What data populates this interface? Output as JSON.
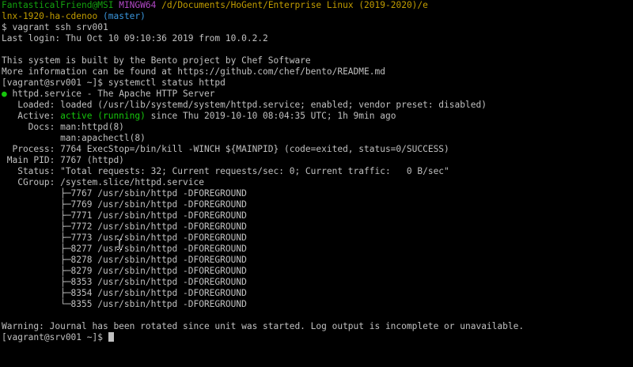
{
  "prompt": {
    "user_host": "FantasticalFriend@MSI",
    "env": "MINGW64",
    "path": "/d/Documents/HoGent/Enterprise Linux (2019-2020)/e",
    "path_cont": "lnx-1920-ha-cdenoo",
    "branch": "(master)",
    "symbol": "$",
    "command": "vagrant ssh srv001"
  },
  "login": "Last login: Thu Oct 10 09:10:36 2019 from 10.0.2.2",
  "motd": [
    "This system is built by the Bento project by Chef Software",
    "More information can be found at https://github.com/chef/bento/README.md"
  ],
  "remote_prompt_1": "[vagrant@srv001 ~]$ systemctl status httpd",
  "status": {
    "bullet": "●",
    "title": " httpd.service - The Apache HTTP Server",
    "loaded": "   Loaded: loaded (/usr/lib/systemd/system/httpd.service; enabled; vendor preset: disabled)",
    "active_label": "   Active: ",
    "active_value": "active (running)",
    "active_rest": " since Thu 2019-10-10 08:04:35 UTC; 1h 9min ago",
    "docs_1": "     Docs: man:httpd(8)",
    "docs_2": "           man:apachectl(8)",
    "process": "  Process: 7764 ExecStop=/bin/kill -WINCH ${MAINPID} (code=exited, status=0/SUCCESS)",
    "main_pid": " Main PID: 7767 (httpd)",
    "status_line": "   Status: \"Total requests: 32; Current requests/sec: 0; Current traffic:   0 B/sec\"",
    "cgroup": "   CGroup: /system.slice/httpd.service",
    "tree": [
      "           ├─7767 /usr/sbin/httpd -DFOREGROUND",
      "           ├─7769 /usr/sbin/httpd -DFOREGROUND",
      "           ├─7771 /usr/sbin/httpd -DFOREGROUND",
      "           ├─7772 /usr/sbin/httpd -DFOREGROUND",
      "           ├─7773 /usr/sbin/httpd -DFOREGROUND",
      "           ├─8277 /usr/sbin/httpd -DFOREGROUND",
      "           ├─8278 /usr/sbin/httpd -DFOREGROUND",
      "           ├─8279 /usr/sbin/httpd -DFOREGROUND",
      "           ├─8353 /usr/sbin/httpd -DFOREGROUND",
      "           ├─8354 /usr/sbin/httpd -DFOREGROUND",
      "           └─8355 /usr/sbin/httpd -DFOREGROUND"
    ]
  },
  "warning": "Warning: Journal has been rotated since unit was started. Log output is incomplete or unavailable.",
  "remote_prompt_2": "[vagrant@srv001 ~]$ ",
  "colors": {
    "background": "#000000",
    "text": "#c0c0c0",
    "user_host": "#13a10e",
    "env": "#b148c6",
    "path": "#c19c00",
    "branch": "#3a96dd",
    "active": "#16c60c"
  }
}
